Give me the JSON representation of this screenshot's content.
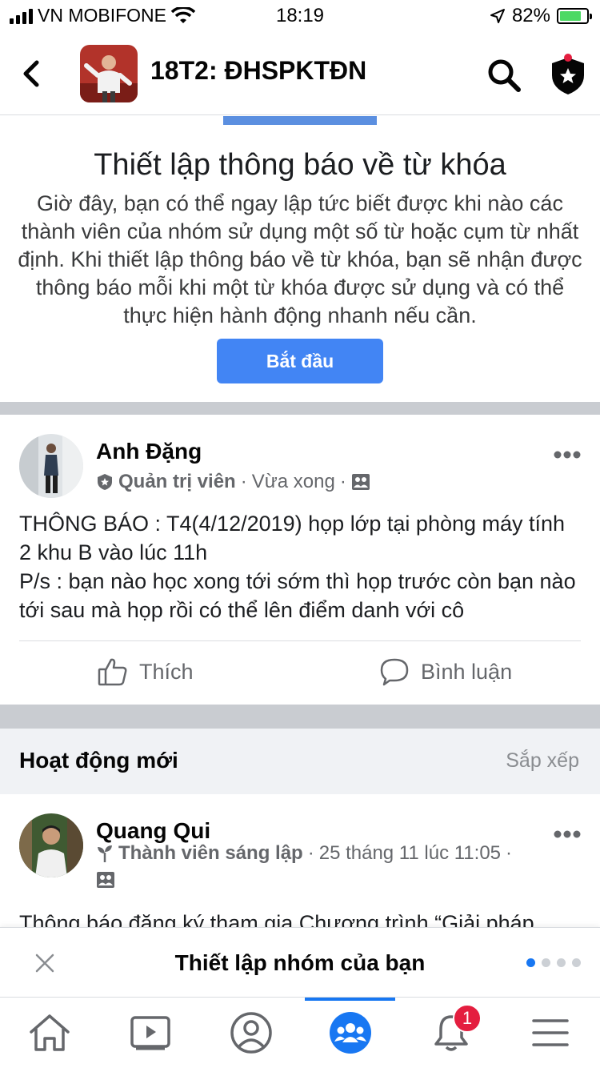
{
  "status_bar": {
    "carrier": "VN MOBIFONE",
    "time": "18:19",
    "battery": "82%",
    "battery_level": 0.82
  },
  "header": {
    "title": "18T2: ĐHSPKTĐN",
    "back_icon": "chevron-left-icon",
    "search_icon": "search-icon",
    "admin_icon": "shield-star-icon"
  },
  "keyword_promo": {
    "title": "Thiết lập thông báo về từ khóa",
    "body": "Giờ đây, bạn có thể ngay lập tức biết được khi nào các thành viên của nhóm sử dụng một số từ hoặc cụm từ nhất định. Khi thiết lập thông báo về từ khóa, bạn sẽ nhận được thông báo mỗi khi một từ khóa được sử dụng và có thể thực hiện hành động nhanh nếu cần.",
    "button_label": "Bắt đầu"
  },
  "post1": {
    "author": "Anh Đặng",
    "role": "Quản trị viên",
    "time": "Vừa xong",
    "separator": "·",
    "text": "THÔNG BÁO : T4(4/12/2019) họp lớp tại phòng máy tính 2 khu B vào lúc 11h\nP/s : bạn nào học xong tới sớm thì họp trước còn bạn nào tới sau mà họp rồi có thể lên điểm danh với cô",
    "like_label": "Thích",
    "comment_label": "Bình luận"
  },
  "activity": {
    "title": "Hoạt động mới",
    "sort_label": "Sắp xếp"
  },
  "post2": {
    "author": "Quang Qui",
    "role": "Thành viên sáng lập",
    "time": "25 tháng 11 lúc 11:05",
    "separator": "·",
    "text": "Thông báo đăng ký tham gia Chương trình “Giải pháp"
  },
  "setup_bar": {
    "title": "Thiết lập nhóm của bạn",
    "pages": 4,
    "active_page": 1
  },
  "tabbar": {
    "tabs": [
      "home-icon",
      "video-icon",
      "profile-icon",
      "groups-icon",
      "notifications-icon",
      "menu-icon"
    ],
    "active_tab": "groups-icon",
    "notification_count": "1"
  },
  "colors": {
    "accent": "#1877f2",
    "button": "#4285f4",
    "badge": "#e41e3f"
  }
}
